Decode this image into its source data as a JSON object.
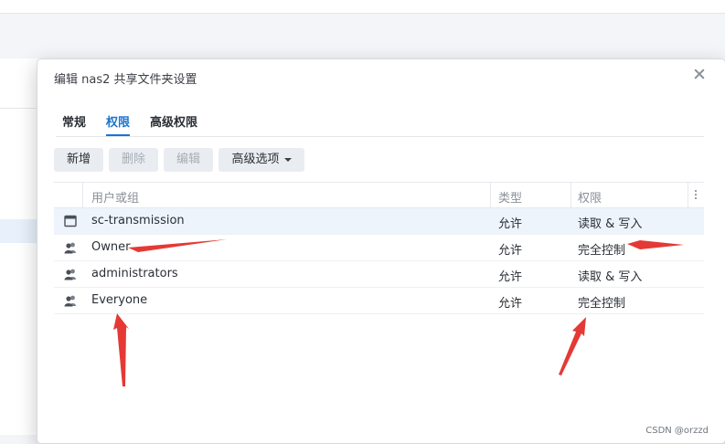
{
  "dialog": {
    "title": "编辑 nas2 共享文件夹设置",
    "tabs": [
      {
        "label": "常规",
        "active": false
      },
      {
        "label": "权限",
        "active": true
      },
      {
        "label": "高级权限",
        "active": false
      }
    ],
    "toolbar": {
      "add": "新增",
      "delete": "删除",
      "edit": "编辑",
      "advanced": "高级选项"
    },
    "table": {
      "headers": {
        "user": "用户或组",
        "type": "类型",
        "permission": "权限"
      },
      "rows": [
        {
          "icon": "window-icon",
          "name": "sc-transmission",
          "type": "允许",
          "permission": "读取 & 写入",
          "selected": true
        },
        {
          "icon": "group-icon",
          "name": "Owner",
          "type": "允许",
          "permission": "完全控制",
          "selected": false
        },
        {
          "icon": "group-icon",
          "name": "administrators",
          "type": "允许",
          "permission": "读取 & 写入",
          "selected": false
        },
        {
          "icon": "group-icon",
          "name": "Everyone",
          "type": "允许",
          "permission": "完全控制",
          "selected": false
        }
      ]
    }
  },
  "watermark": "CSDN @orzzd",
  "colors": {
    "accent": "#1a74d0",
    "annotation": "#e53935"
  }
}
